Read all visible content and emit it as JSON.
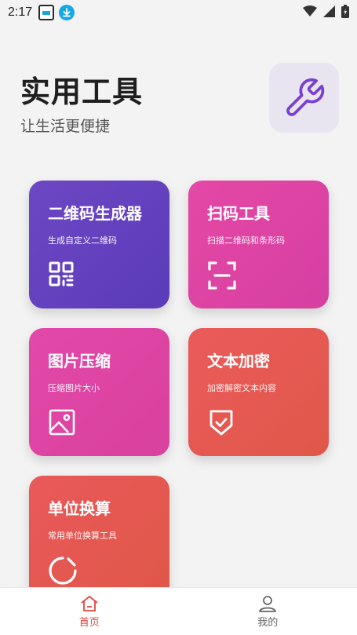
{
  "status_bar": {
    "time": "2:17",
    "icons": [
      "app-notification-icon",
      "download-icon",
      "wifi-icon",
      "signal-icon",
      "battery-icon"
    ]
  },
  "header": {
    "title": "实用工具",
    "subtitle": "让生活更便捷",
    "tile_icon": "wrench-icon",
    "tile_color": "#7a3fd0"
  },
  "tools": [
    {
      "title": "二维码生成器",
      "desc": "生成自定义二维码",
      "icon": "qrcode-icon"
    },
    {
      "title": "扫码工具",
      "desc": "扫描二维码和条形码",
      "icon": "scan-icon"
    },
    {
      "title": "图片压缩",
      "desc": "压缩图片大小",
      "icon": "image-icon"
    },
    {
      "title": "文本加密",
      "desc": "加密解密文本内容",
      "icon": "shield-check-icon"
    },
    {
      "title": "单位换算",
      "desc": "常用单位换算工具",
      "icon": "refresh-icon"
    }
  ],
  "bottom_nav": [
    {
      "label": "首页",
      "icon": "home-icon",
      "active": true
    },
    {
      "label": "我的",
      "icon": "user-icon",
      "active": false
    }
  ],
  "colors": {
    "accent": "#e2453c",
    "purple": "#6d47c4",
    "pink": "#e548a6",
    "red": "#ea5a5b"
  }
}
